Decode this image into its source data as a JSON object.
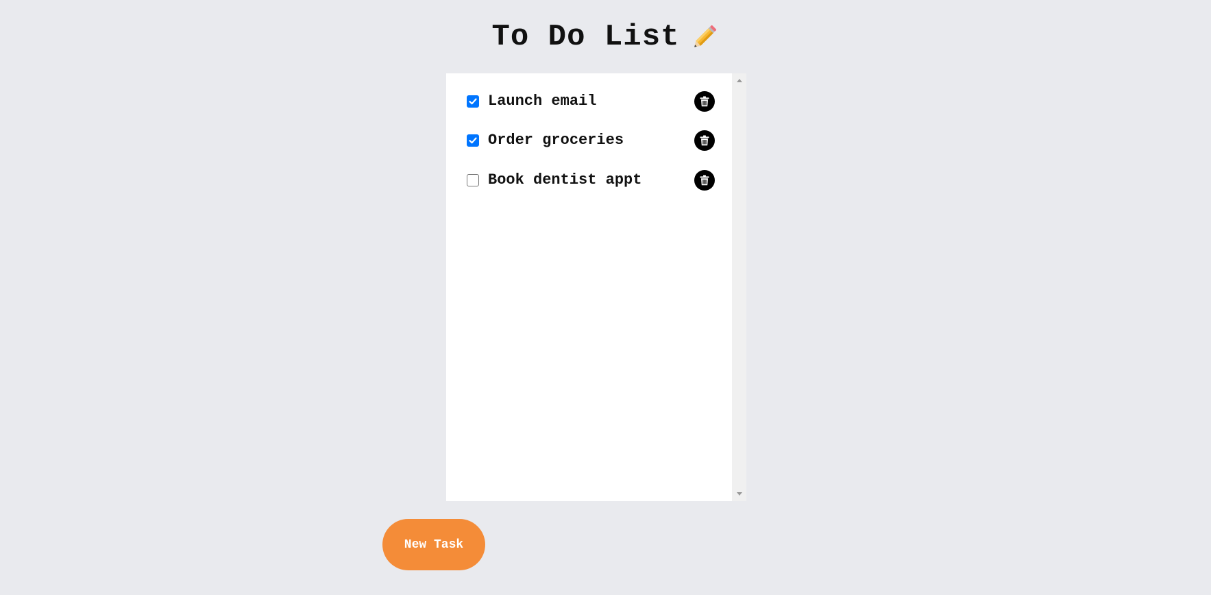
{
  "header": {
    "title": "To Do List",
    "title_icon": "pencil-icon"
  },
  "tasks": [
    {
      "label": "Launch email",
      "checked": true
    },
    {
      "label": "Order groceries",
      "checked": true
    },
    {
      "label": "Book dentist appt",
      "checked": false
    }
  ],
  "task_action_icon": "trash-icon",
  "actions": {
    "new_task_label": "New Task"
  },
  "colors": {
    "background": "#e9eaee",
    "panel": "#ffffff",
    "checkbox_checked": "#0075ff",
    "new_task_button": "#f48c38",
    "delete_button": "#000000"
  }
}
